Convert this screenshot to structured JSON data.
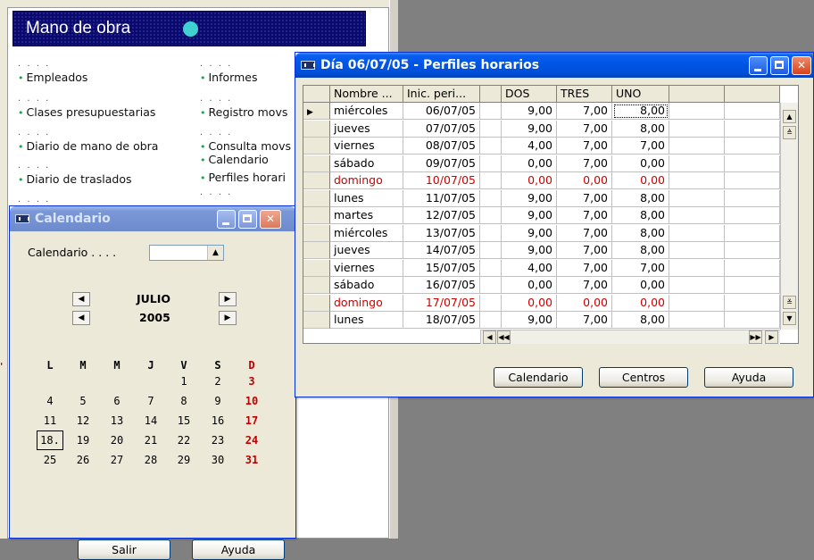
{
  "main": {
    "banner_title": "Mano de obra",
    "dots": ". . . .",
    "bullet": "•",
    "menu_left": [
      "Empleados",
      "Clases presupuestarias",
      "Diario de mano de obra",
      "Diario de traslados"
    ],
    "menu_right": [
      "Informes",
      "Registro movs",
      "Consulta movs",
      "Calendario",
      "Perfiles horari"
    ]
  },
  "calendar_window": {
    "title": "Calendario",
    "field_label": "Calendario . . . .",
    "combo_value": "",
    "month": "JULIO",
    "year": "2005",
    "weekdays": [
      "L",
      "M",
      "M",
      "J",
      "V",
      "S",
      "D"
    ],
    "weeks": [
      [
        "",
        "",
        "",
        "",
        "1",
        "2",
        "3"
      ],
      [
        "4",
        "5",
        "6",
        "7",
        "8",
        "9",
        "10"
      ],
      [
        "11",
        "12",
        "13",
        "14",
        "15",
        "16",
        "17"
      ],
      [
        "18.",
        "19",
        "20",
        "21",
        "22",
        "23",
        "24"
      ],
      [
        "25",
        "26",
        "27",
        "28",
        "29",
        "30",
        "31"
      ]
    ],
    "today": "18.",
    "buttons": {
      "salir": "Salir",
      "ayuda": "Ayuda"
    }
  },
  "profiles_window": {
    "title": "Día 06/07/05 - Perfiles horarios",
    "columns": [
      "Nombre ...",
      "Inic. peri...",
      "",
      "DOS",
      "TRES",
      "UNO",
      "",
      ""
    ],
    "rows": [
      {
        "nombre": "miércoles",
        "fecha": "06/07/05",
        "dos": "9,00",
        "tres": "7,00",
        "uno": "8,00",
        "current": true,
        "sunday": false
      },
      {
        "nombre": "jueves",
        "fecha": "07/07/05",
        "dos": "9,00",
        "tres": "7,00",
        "uno": "8,00",
        "current": false,
        "sunday": false
      },
      {
        "nombre": "viernes",
        "fecha": "08/07/05",
        "dos": "4,00",
        "tres": "7,00",
        "uno": "7,00",
        "current": false,
        "sunday": false
      },
      {
        "nombre": "sábado",
        "fecha": "09/07/05",
        "dos": "0,00",
        "tres": "7,00",
        "uno": "0,00",
        "current": false,
        "sunday": false
      },
      {
        "nombre": "domingo",
        "fecha": "10/07/05",
        "dos": "0,00",
        "tres": "0,00",
        "uno": "0,00",
        "current": false,
        "sunday": true
      },
      {
        "nombre": "lunes",
        "fecha": "11/07/05",
        "dos": "9,00",
        "tres": "7,00",
        "uno": "8,00",
        "current": false,
        "sunday": false
      },
      {
        "nombre": "martes",
        "fecha": "12/07/05",
        "dos": "9,00",
        "tres": "7,00",
        "uno": "8,00",
        "current": false,
        "sunday": false
      },
      {
        "nombre": "miércoles",
        "fecha": "13/07/05",
        "dos": "9,00",
        "tres": "7,00",
        "uno": "8,00",
        "current": false,
        "sunday": false
      },
      {
        "nombre": "jueves",
        "fecha": "14/07/05",
        "dos": "9,00",
        "tres": "7,00",
        "uno": "8,00",
        "current": false,
        "sunday": false
      },
      {
        "nombre": "viernes",
        "fecha": "15/07/05",
        "dos": "4,00",
        "tres": "7,00",
        "uno": "7,00",
        "current": false,
        "sunday": false
      },
      {
        "nombre": "sábado",
        "fecha": "16/07/05",
        "dos": "0,00",
        "tres": "7,00",
        "uno": "0,00",
        "current": false,
        "sunday": false
      },
      {
        "nombre": "domingo",
        "fecha": "17/07/05",
        "dos": "0,00",
        "tres": "0,00",
        "uno": "0,00",
        "current": false,
        "sunday": true
      },
      {
        "nombre": "lunes",
        "fecha": "18/07/05",
        "dos": "9,00",
        "tres": "7,00",
        "uno": "8,00",
        "current": false,
        "sunday": false
      }
    ],
    "buttons": {
      "calendario": "Calendario",
      "centros": "Centros",
      "ayuda": "Ayuda"
    }
  },
  "colors": {
    "sunday_red": "#d00000",
    "xp_blue": "#0054e3",
    "banner_navy": "#0a0a6e",
    "banner_dot": "#3fd0d0"
  },
  "icons": {
    "window_app": "app-window-icon",
    "row_pointer": "triangle-right-icon",
    "combo": "arrow-up-icon"
  }
}
